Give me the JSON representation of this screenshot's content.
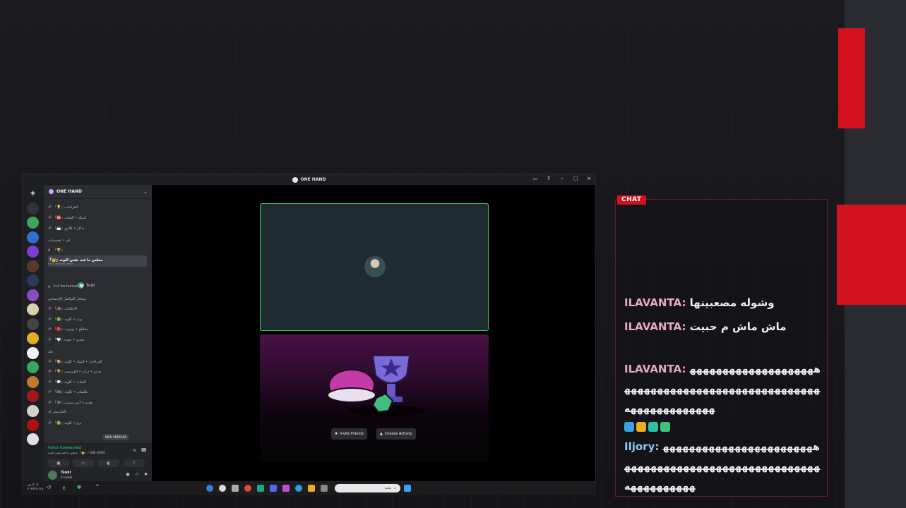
{
  "window": {
    "title": "ONE HAND"
  },
  "server": {
    "name": "ONE HAND"
  },
  "channels": [
    {
      "name": "『💡』اقتراحات"
    },
    {
      "name": "『🆘』اسئلة • الشات"
    },
    {
      "name": "『📩』تذاكر • كلاتيح"
    },
    {
      "name": "『🏆』"
    },
    {
      "name": "『👑』مجلس ما فيه نفس لكونه"
    },
    {
      "name": "1v1 ba human 🤍"
    },
    {
      "name": "『📣』الاعلانات"
    },
    {
      "name": "『🟢』بوت • كلونه"
    },
    {
      "name": "『🔴』مقاطع • يوتيوب"
    },
    {
      "name": "『🤍』تحدي • عوده"
    },
    {
      "name": "『🎨』اقتراحات • الميك • كلونه"
    },
    {
      "name": "『🏆』تقديم • درايه • الفيرمس"
    },
    {
      "name": "『💬』الشات • كلونه"
    },
    {
      "name": "『🎟』تكليفات • كلونه"
    },
    {
      "name": "『🛡』تقديم • أمير سريتر"
    },
    {
      "name": "المارميتر"
    },
    {
      "name": "『🟢』ترم • كلونه"
    }
  ],
  "channel_categories": [
    {
      "name": "كير • تقسيمات"
    },
    {
      "name": "وسائل التواصل الإجتماعي"
    },
    {
      "name": "فئة"
    }
  ],
  "voice_channel_status": "Set a channel status",
  "voice_user": {
    "name": "Tsuki"
  },
  "new_unreads": "NEW UNREADS",
  "voice_panel": {
    "title": "Voice Connected",
    "subtitle": "مجلس ما فيه نفس لكونه 『👑』/ ONE HAND"
  },
  "user_panel": {
    "name": "Tsuki",
    "status": "Invisible"
  },
  "activity": {
    "invite_label": "Invite Friends",
    "choose_label": "Choose Activity"
  },
  "taskbar": {
    "time": "٤:٠٤ ص",
    "date": "٢٠٢٥/١١/١٨",
    "search_placeholder": "بحث"
  },
  "chat": {
    "label": "CHAT",
    "messages": [
      {
        "user": "ILAVANTA:",
        "text": "وشوله مصعبينها"
      },
      {
        "user": "ILAVANTA:",
        "text": "ماش ماش م حبيت"
      },
      {
        "user": "ILAVANTA:",
        "text": "هههههههههههههههههههههههههههههههههههههههههههههههههههههههههههههههه"
      },
      {
        "user": "Iljory:",
        "text": "ههههههههههههههههههههههههههههههههههههههههههههههههههههههههههههههههه"
      }
    ]
  },
  "colors": {
    "accent_red": "#d3121f",
    "discord_green": "#43c255",
    "chat_user": "#e7a8c8",
    "chat_user_alt": "#8ec8f0"
  }
}
